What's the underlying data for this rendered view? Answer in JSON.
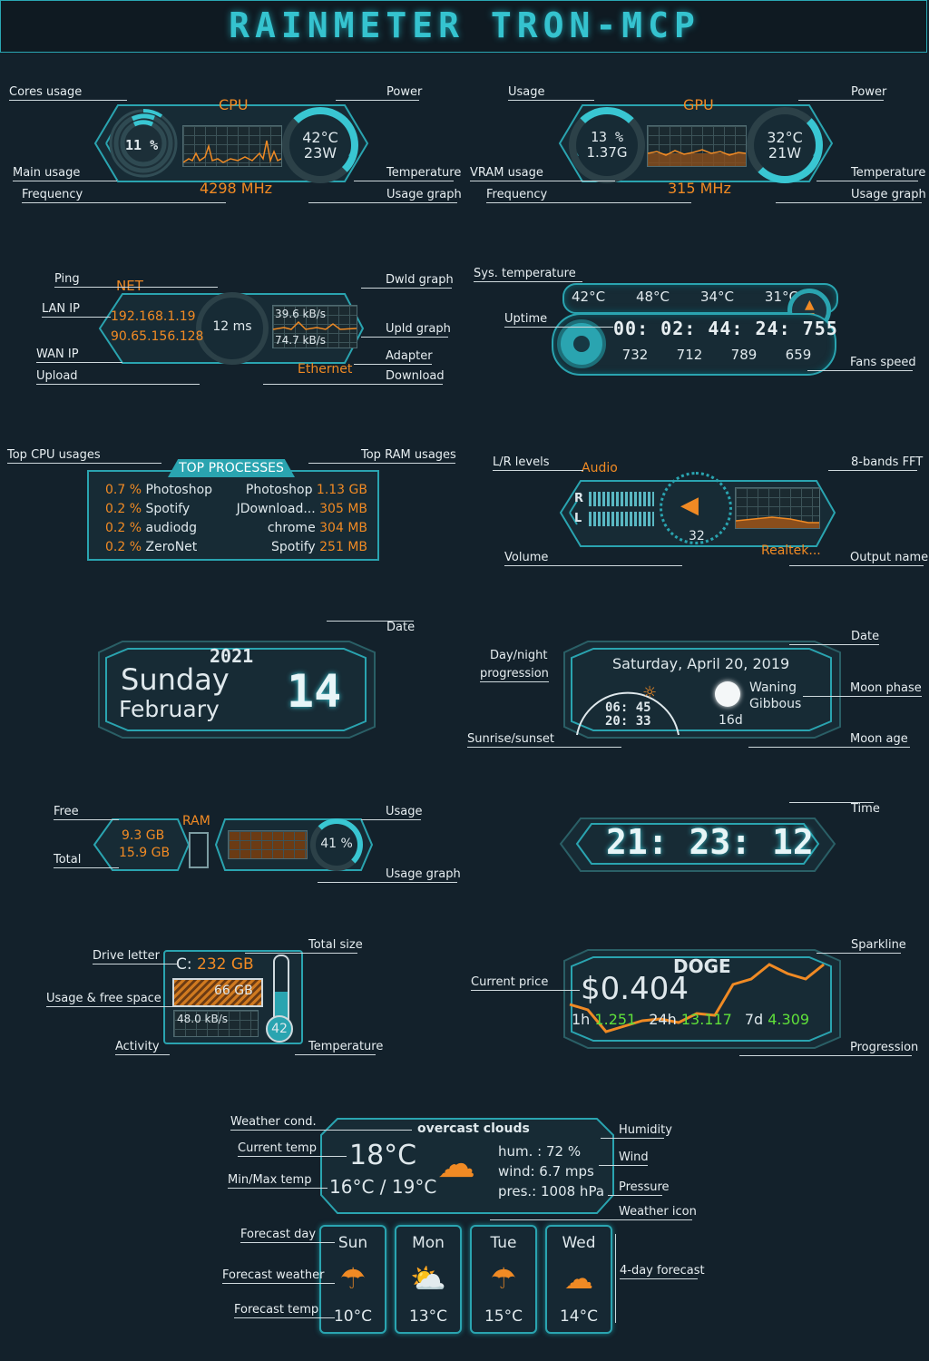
{
  "header": {
    "title": "RAINMETER TRON-MCP"
  },
  "cpu": {
    "title": "CPU",
    "usage": "11 %",
    "temp": "42°C",
    "power": "23W",
    "freq": "4298 MHz",
    "labels": {
      "cores_usage": "Cores usage",
      "main_usage": "Main usage",
      "frequency": "Frequency",
      "power": "Power",
      "temperature": "Temperature",
      "usage_graph": "Usage graph"
    }
  },
  "gpu": {
    "title": "GPU",
    "usage": "13 %",
    "vram": "1.37G",
    "temp": "32°C",
    "power": "21W",
    "freq": "315 MHz",
    "labels": {
      "usage": "Usage",
      "vram_usage": "VRAM usage",
      "frequency": "Frequency",
      "power": "Power",
      "temperature": "Temperature",
      "usage_graph": "Usage graph"
    }
  },
  "net": {
    "title": "NET",
    "lan_ip": "192.168.1.19",
    "wan_ip": "90.65.156.128",
    "ping": "12 ms",
    "download_rate": "39.6 kB/s",
    "upload_rate": "74.7 kB/s",
    "adapter": "Ethernet",
    "labels": {
      "ping": "Ping",
      "lan_ip": "LAN IP",
      "wan_ip": "WAN IP",
      "upload": "Upload",
      "dwld_graph": "Dwld graph",
      "upld_graph": "Upld graph",
      "adapter": "Adapter",
      "download": "Download"
    }
  },
  "sys": {
    "temps": [
      "42°C",
      "48°C",
      "34°C",
      "31°C"
    ],
    "uptime": "00: 02: 44: 24: 755",
    "fans": [
      "732",
      "712",
      "789",
      "659"
    ],
    "labels": {
      "sys_temperature": "Sys. temperature",
      "uptime": "Uptime",
      "fans_speed": "Fans speed"
    }
  },
  "top": {
    "title": "TOP PROCESSES",
    "cpu": [
      {
        "pct": "0.7 %",
        "name": "Photoshop"
      },
      {
        "pct": "0.2 %",
        "name": "Spotify"
      },
      {
        "pct": "0.2 %",
        "name": "audiodg"
      },
      {
        "pct": "0.2 %",
        "name": "ZeroNet"
      }
    ],
    "ram": [
      {
        "name": "Photoshop",
        "size": "1.13 GB"
      },
      {
        "name": "JDownload...",
        "size": "305 MB"
      },
      {
        "name": "chrome",
        "size": "304 MB"
      },
      {
        "name": "Spotify",
        "size": "251 MB"
      }
    ],
    "labels": {
      "top_cpu": "Top CPU usages",
      "top_ram": "Top RAM usages"
    }
  },
  "audio": {
    "title": "Audio",
    "r": "R",
    "l": "L",
    "volume_value": "32",
    "output": "Realtek...",
    "labels": {
      "lr_levels": "L/R levels",
      "fft": "8-bands FFT",
      "volume": "Volume",
      "output_name": "Output name"
    }
  },
  "date1": {
    "year": "2021",
    "weekday": "Sunday",
    "month": "February",
    "day": "14",
    "label": "Date"
  },
  "moon": {
    "date": "Saturday, April 20, 2019",
    "sunrise": "06: 45",
    "sunset": "20: 33",
    "phase": "Waning Gibbous",
    "age": "16d",
    "labels": {
      "day_night": "Day/night",
      "progression": "progression",
      "sunrise_sunset": "Sunrise/sunset",
      "date": "Date",
      "moon_phase": "Moon phase",
      "moon_age": "Moon age"
    }
  },
  "ram": {
    "title": "RAM",
    "free": "9.3 GB",
    "total": "15.9 GB",
    "usage": "41 %",
    "labels": {
      "free": "Free",
      "total": "Total",
      "usage": "Usage",
      "usage_graph": "Usage graph"
    }
  },
  "clock": {
    "time": "21: 23: 12",
    "label": "Time"
  },
  "drive": {
    "letter": "C:",
    "total": "232 GB",
    "free": "66 GB",
    "activity": "48.0 kB/s",
    "temp": "42",
    "labels": {
      "drive_letter": "Drive letter",
      "usage_free": "Usage & free space",
      "activity": "Activity",
      "total_size": "Total size",
      "temperature": "Temperature"
    }
  },
  "crypto": {
    "name": "DOGE",
    "price": "$0.404",
    "h1_label": "1h",
    "h1": "1.251",
    "h24_label": "24h",
    "h24": "13.117",
    "d7_label": "7d",
    "d7": "4.309",
    "labels": {
      "current_price": "Current price",
      "sparkline": "Sparkline",
      "progression": "Progression"
    }
  },
  "weather": {
    "cond": "overcast clouds",
    "temp": "18°C",
    "minmax": "16°C / 19°C",
    "hum": "hum. : 72 %",
    "wind": "wind: 6.7 mps",
    "pres": "pres.: 1008 hPa",
    "forecast": [
      {
        "day": "Sun",
        "temp": "10°C"
      },
      {
        "day": "Mon",
        "temp": "13°C"
      },
      {
        "day": "Tue",
        "temp": "15°C"
      },
      {
        "day": "Wed",
        "temp": "14°C"
      }
    ],
    "labels": {
      "weather_cond": "Weather cond.",
      "current_temp": "Current temp",
      "minmax_temp": "Min/Max temp",
      "humidity": "Humidity",
      "wind": "Wind",
      "pressure": "Pressure",
      "weather_icon": "Weather icon",
      "forecast_day": "Forecast day",
      "forecast_weather": "Forecast weather",
      "forecast_temp": "Forecast temp",
      "four_day": "4-day forecast"
    }
  }
}
